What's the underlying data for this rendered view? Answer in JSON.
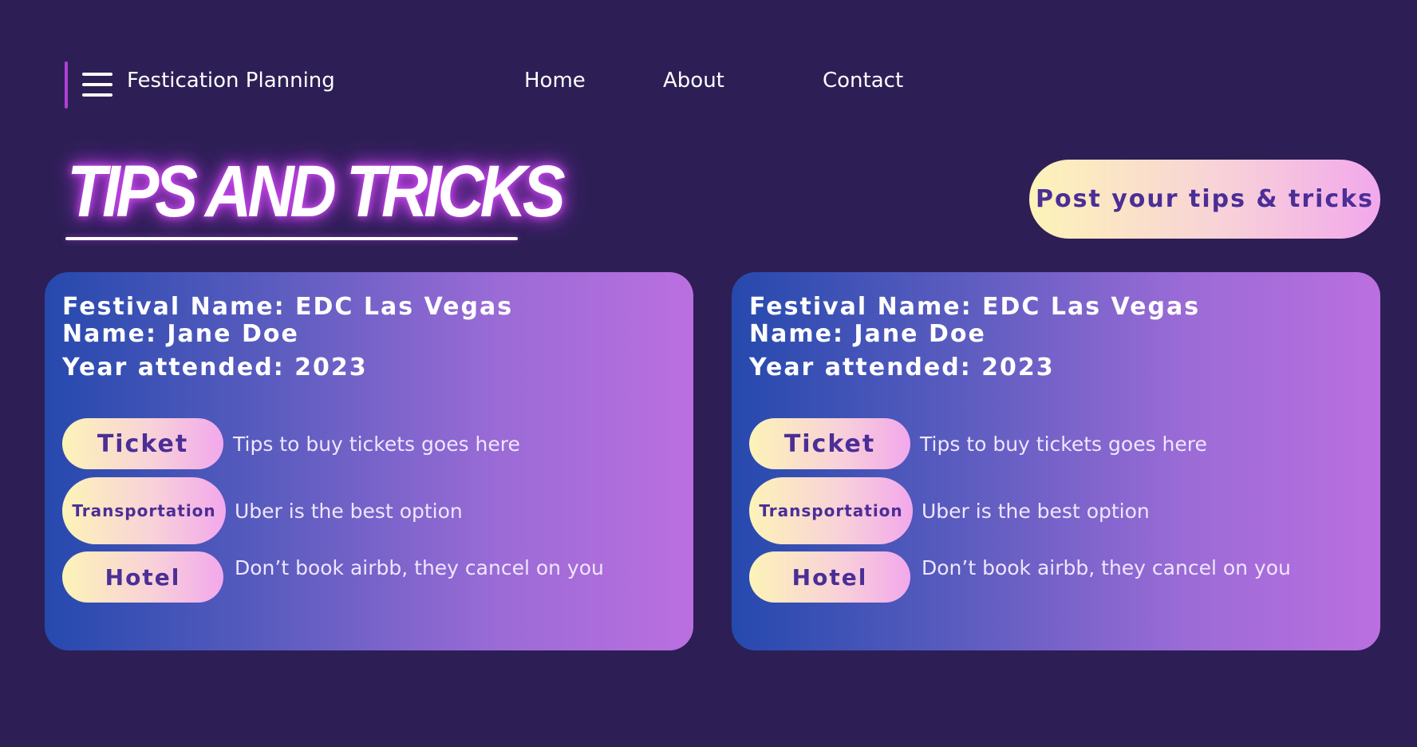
{
  "header": {
    "brand": "Festication Planning",
    "menu_icon": "hamburger-menu-icon",
    "nav": [
      {
        "label": "Home"
      },
      {
        "label": "About"
      },
      {
        "label": "Contact"
      }
    ]
  },
  "page": {
    "title": "TIPS AND TRICKS",
    "post_button_label": "Post your tips & tricks"
  },
  "colors": {
    "background": "#2d1f55",
    "accent": "#b13fd6",
    "pill_text": "#4b2e96",
    "card_gradient_start": "#2649ae",
    "card_gradient_end": "#bb6fe0",
    "pill_gradient_start": "#fdf3b8",
    "pill_gradient_end": "#f2a8ec"
  },
  "cards": [
    {
      "festival": "Festival Name: EDC Las Vegas",
      "name": "Name: Jane Doe",
      "year": "Year attended: 2023",
      "tips": [
        {
          "category": "Ticket",
          "text": "Tips to buy tickets goes here"
        },
        {
          "category": "Transportation",
          "text": "Uber is the best option"
        },
        {
          "category": "Hotel",
          "text": "Don’t book airbb, they cancel on you"
        }
      ]
    },
    {
      "festival": "Festival Name: EDC Las Vegas",
      "name": "Name: Jane Doe",
      "year": "Year attended: 2023",
      "tips": [
        {
          "category": "Ticket",
          "text": "Tips to buy tickets goes here"
        },
        {
          "category": "Transportation",
          "text": "Uber is the best option"
        },
        {
          "category": "Hotel",
          "text": "Don’t book airbb, they cancel on you"
        }
      ]
    }
  ]
}
